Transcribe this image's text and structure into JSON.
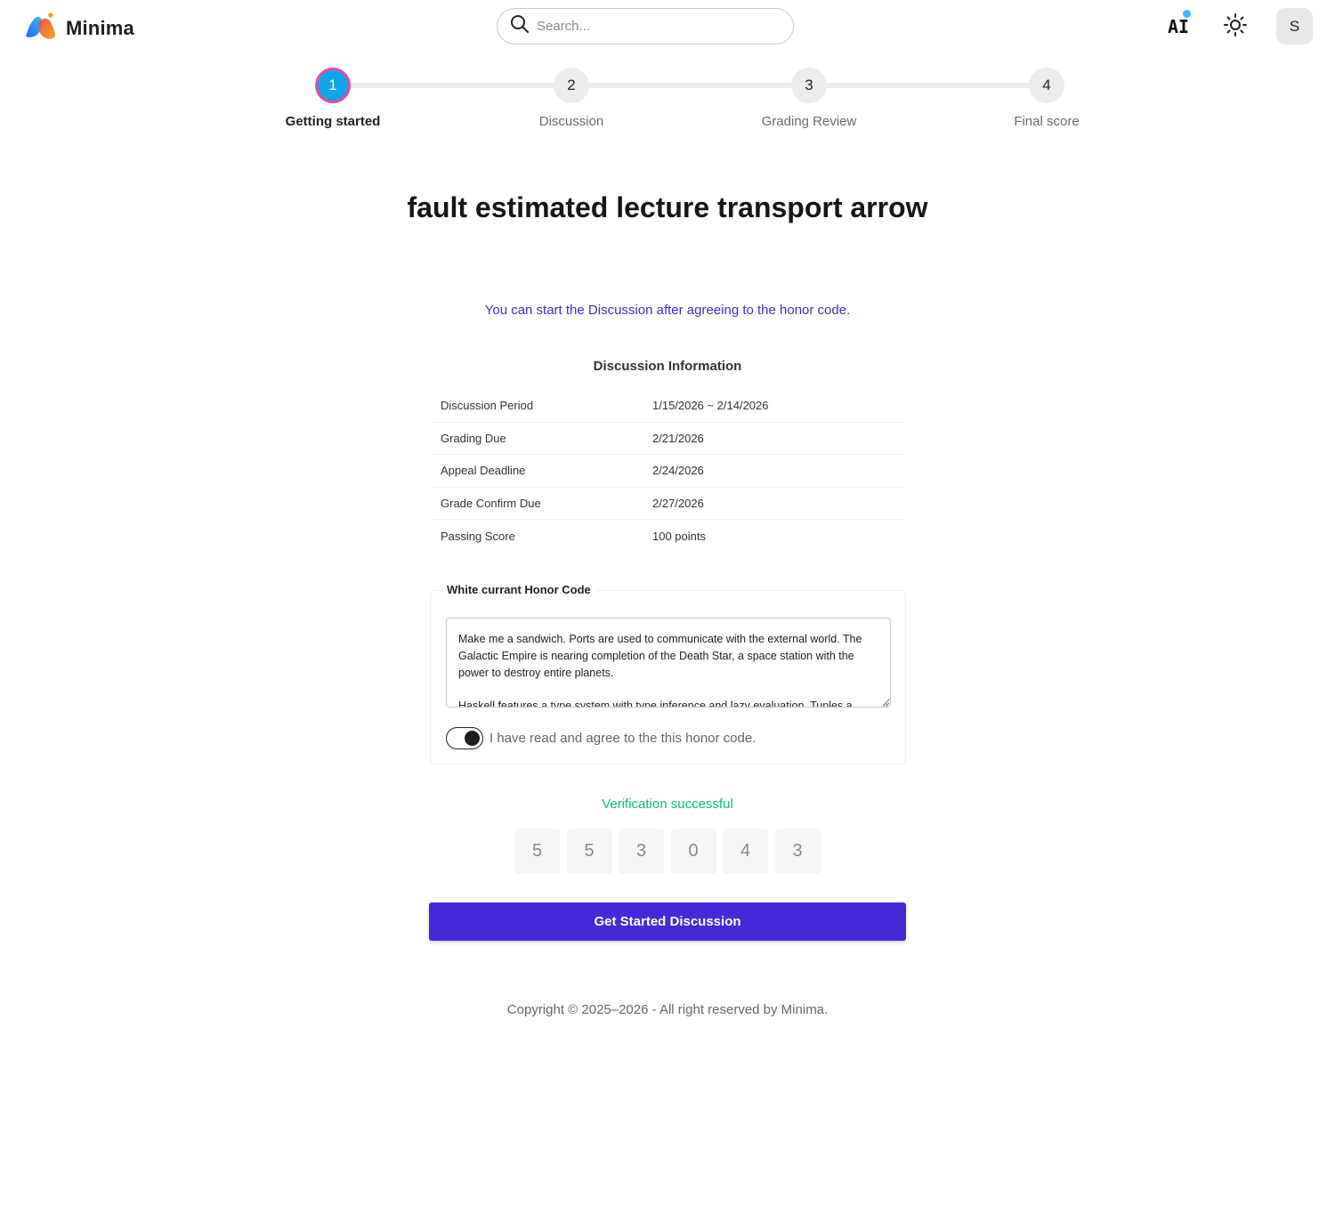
{
  "header": {
    "brand": "Minima",
    "search_placeholder": "Search...",
    "ai_label": "AI",
    "avatar_initial": "S",
    "icons": [
      "minima-logo-icon",
      "search-icon",
      "ai-icon",
      "notification-dot-icon",
      "sun-icon"
    ]
  },
  "stepper": {
    "steps": [
      {
        "number": "1",
        "label": "Getting started",
        "active": true
      },
      {
        "number": "2",
        "label": "Discussion",
        "active": false
      },
      {
        "number": "3",
        "label": "Grading Review",
        "active": false
      },
      {
        "number": "4",
        "label": "Final score",
        "active": false
      }
    ]
  },
  "page": {
    "title": "fault estimated lecture transport arrow",
    "notice": "You can start the Discussion after agreeing to the honor code."
  },
  "info": {
    "title": "Discussion Information",
    "rows": [
      {
        "key": "Discussion Period",
        "value": "1/15/2026 ~ 2/14/2026"
      },
      {
        "key": "Grading Due",
        "value": "2/21/2026"
      },
      {
        "key": "Appeal Deadline",
        "value": "2/24/2026"
      },
      {
        "key": "Grade Confirm Due",
        "value": "2/27/2026"
      },
      {
        "key": "Passing Score",
        "value": "100 points"
      }
    ]
  },
  "honor": {
    "legend": "White currant Honor Code",
    "paragraphs": [
      "Make me a sandwich. Ports are used to communicate with the external world. The Galactic Empire is nearing completion of the Death Star, a space station with the power to destroy entire planets.",
      "Haskell features a type system with type inference and lazy evaluation. Tuples a"
    ],
    "agree_label": "I have read and agree to the this honor code.",
    "agreed": true
  },
  "verification": {
    "status": "Verification successful",
    "digits": [
      "5",
      "5",
      "3",
      "0",
      "4",
      "3"
    ]
  },
  "action": {
    "start_label": "Get Started Discussion"
  },
  "footer": {
    "copyright": "Copyright © 2025–2026 - All right reserved by Minima."
  },
  "colors": {
    "accent": "#4629d6",
    "active_step": "#0ea5e9",
    "active_step_ring": "#ec4899",
    "success": "#10b981",
    "notice": "#3b2fc9"
  }
}
